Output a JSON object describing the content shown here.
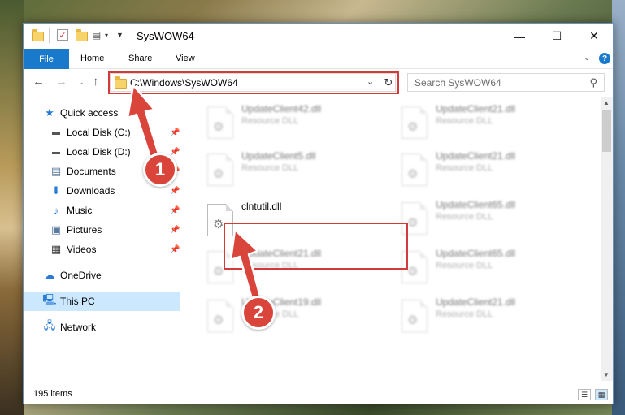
{
  "window": {
    "title": "SysWOW64",
    "minimize": "—",
    "maximize": "☐",
    "close": "✕"
  },
  "ribbon": {
    "file": "File",
    "home": "Home",
    "share": "Share",
    "view": "View",
    "help": "?"
  },
  "address": {
    "path": "C:\\Windows\\SysWOW64",
    "search_placeholder": "Search SysWOW64"
  },
  "sidebar": {
    "items": [
      {
        "label": "Quick access",
        "icon": "star-icon"
      },
      {
        "label": "Local Disk (C:)",
        "icon": "drive-icon"
      },
      {
        "label": "Local Disk (D:)",
        "icon": "drive-icon"
      },
      {
        "label": "Documents",
        "icon": "documents-icon"
      },
      {
        "label": "Downloads",
        "icon": "download-icon"
      },
      {
        "label": "Music",
        "icon": "music-icon"
      },
      {
        "label": "Pictures",
        "icon": "pictures-icon"
      },
      {
        "label": "Videos",
        "icon": "videos-icon"
      },
      {
        "label": "OneDrive",
        "icon": "cloud-icon"
      },
      {
        "label": "This PC",
        "icon": "computer-icon"
      },
      {
        "label": "Network",
        "icon": "network-icon"
      }
    ]
  },
  "files": [
    {
      "name": "UpdateClient42.dll",
      "type": "Resource DLL"
    },
    {
      "name": "UpdateClient21.dll",
      "type": "Resource DLL"
    },
    {
      "name": "UpdateClient5.dll",
      "type": "Resource DLL"
    },
    {
      "name": "UpdateClient21.dll",
      "type": "Resource DLL"
    },
    {
      "name": "clntutil.dll",
      "type": ""
    },
    {
      "name": "UpdateClient65.dll",
      "type": "Resource DLL"
    },
    {
      "name": "UpdateClient21.dll",
      "type": "Resource DLL"
    },
    {
      "name": "UpdateClient65.dll",
      "type": "Resource DLL"
    },
    {
      "name": "UpdateClient19.dll",
      "type": "Resource DLL"
    },
    {
      "name": "UpdateClient21.dll",
      "type": "Resource DLL"
    }
  ],
  "status": {
    "item_count": "195 items"
  },
  "annotations": {
    "step1": "1",
    "step2": "2",
    "color": "#d33a3a"
  }
}
